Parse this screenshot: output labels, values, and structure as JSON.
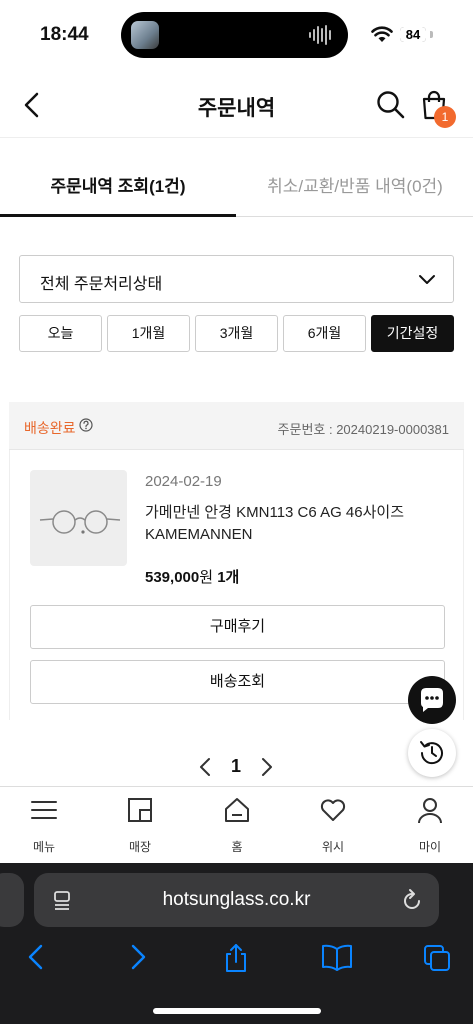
{
  "status_bar": {
    "time": "18:44",
    "battery": "84"
  },
  "header": {
    "title": "주문내역",
    "cart_count": "1"
  },
  "tabs": [
    {
      "label": "주문내역 조회(1건)",
      "active": true
    },
    {
      "label": "취소/교환/반품 내역(0건)",
      "active": false
    }
  ],
  "filter": {
    "status_select": "전체 주문처리상태",
    "periods": [
      "오늘",
      "1개월",
      "3개월",
      "6개월",
      "기간설정"
    ],
    "selected_period": "기간설정"
  },
  "order": {
    "status": "배송완료",
    "order_number": "주문번호 : 20240219-0000381",
    "date": "2024-02-19",
    "product_name": "가메만넨 안경 KMN113 C6 AG 46사이즈",
    "brand": "KAMEMANNEN",
    "price": "539,000",
    "price_unit": "원",
    "quantity": "1개",
    "review_button": "구매후기",
    "tracking_button": "배송조회"
  },
  "pagination": {
    "current": "1"
  },
  "bottom_nav": [
    {
      "label": "메뉴",
      "icon": "menu-icon"
    },
    {
      "label": "매장",
      "icon": "store-icon"
    },
    {
      "label": "홈",
      "icon": "home-icon"
    },
    {
      "label": "위시",
      "icon": "heart-icon"
    },
    {
      "label": "마이",
      "icon": "user-icon"
    }
  ],
  "browser": {
    "url": "hotsunglass.co.kr"
  },
  "colors": {
    "accent": "#f26a2e",
    "status_orange": "#e8672b",
    "browser_bg": "#1c1c1e",
    "ios_blue": "#0a84ff"
  }
}
